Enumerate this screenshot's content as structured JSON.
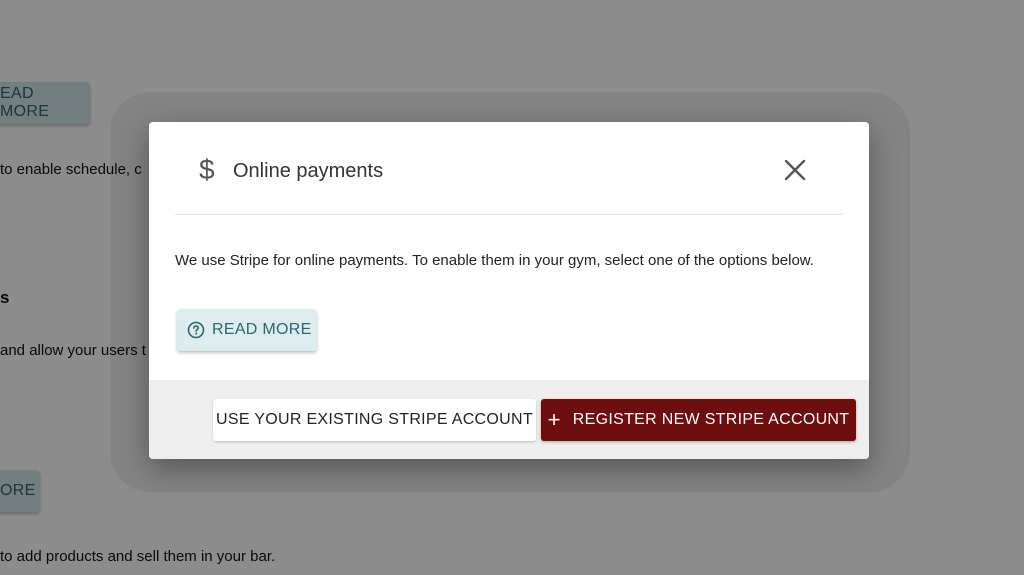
{
  "background": {
    "read_more_label_1": "EAD MORE",
    "text_1": "to enable schedule, c",
    "heading_1": "s",
    "text_2": "and allow your users t",
    "read_more_label_2": "ORE",
    "text_3": "to add products and sell them in your bar."
  },
  "dialog": {
    "icon": "dollar-icon",
    "title": "Online payments",
    "close_icon": "close-icon",
    "body_text": "We use Stripe for online payments. To enable them in your gym, select one of the options below.",
    "read_more": {
      "icon": "help-circle-icon",
      "label": "READ MORE"
    },
    "footer": {
      "existing_account_label": "USE YOUR EXISTING STRIPE ACCOUNT",
      "register_icon": "plus-icon",
      "register_label": "REGISTER NEW STRIPE ACCOUNT"
    }
  },
  "colors": {
    "primary": "#6f0e0e",
    "secondary_bg": "#dcecef",
    "secondary_text": "#2f6470",
    "footer_bg": "#eeeeee"
  }
}
